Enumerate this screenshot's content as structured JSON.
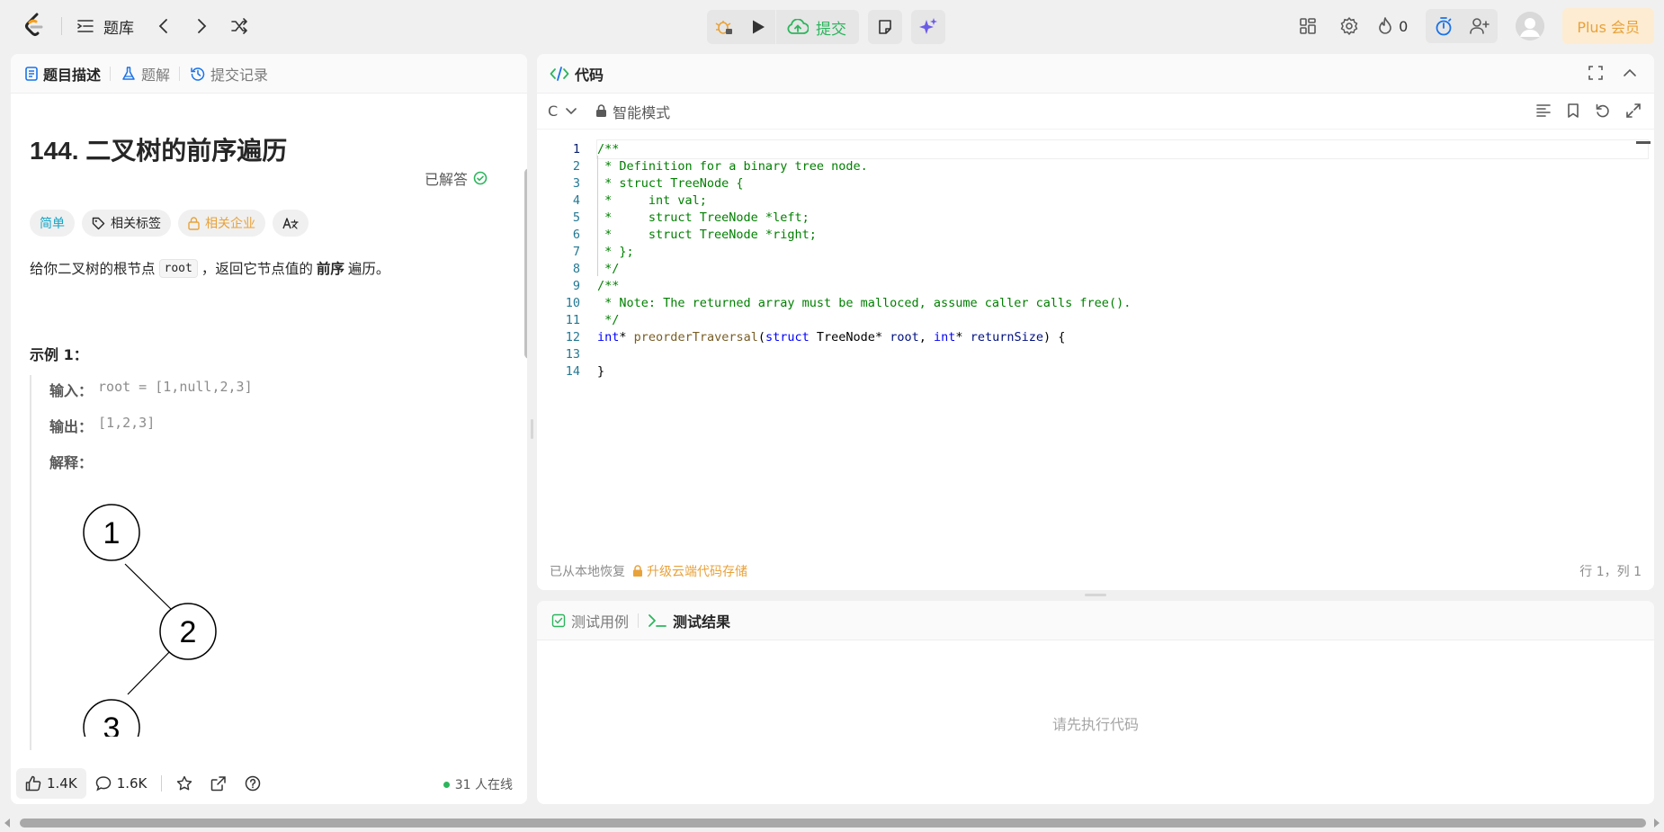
{
  "topbar": {
    "problemset_label": "题库",
    "submit_label": "提交",
    "streak_count": "0",
    "plus_label": "Plus 会员"
  },
  "left_panel": {
    "tabs": [
      {
        "label": "题目描述"
      },
      {
        "label": "题解"
      },
      {
        "label": "提交记录"
      }
    ],
    "title": "144. 二叉树的前序遍历",
    "solved_label": "已解答",
    "tags": {
      "difficulty": "简单",
      "related_tags": "相关标签",
      "companies": "相关企业"
    },
    "description": {
      "before": "给你二叉树的根节点",
      "code": "root",
      "middle": "，返回它节点值的",
      "bold": "前序",
      "after": "遍历。"
    },
    "example": {
      "title": "示例 1：",
      "input_label": "输入：",
      "input_value": "root = [1,null,2,3]",
      "output_label": "输出：",
      "output_value": "[1,2,3]",
      "explain_label": "解释：",
      "tree_nodes": [
        "1",
        "2",
        "3"
      ]
    },
    "footer": {
      "likes": "1.4K",
      "comments": "1.6K",
      "online": "31 人在线"
    }
  },
  "code_panel": {
    "title": "代码",
    "language": "C",
    "mode": "智能模式",
    "lines": [
      "/**",
      " * Definition for a binary tree node.",
      " * struct TreeNode {",
      " *     int val;",
      " *     struct TreeNode *left;",
      " *     struct TreeNode *right;",
      " * };",
      " */",
      "/**",
      " * Note: The returned array must be malloced, assume caller calls free().",
      " */",
      "int* preorderTraversal(struct TreeNode* root, int* returnSize) {",
      "",
      "}"
    ],
    "line_numbers": [
      "1",
      "2",
      "3",
      "4",
      "5",
      "6",
      "7",
      "8",
      "9",
      "10",
      "11",
      "12",
      "13",
      "14"
    ],
    "status_restored": "已从本地恢复",
    "status_upgrade": "升级云端代码存储",
    "cursor_pos": "行 1，列 1"
  },
  "test_panel": {
    "tabs": [
      {
        "label": "测试用例"
      },
      {
        "label": "测试结果"
      }
    ],
    "empty_text": "请先执行代码"
  },
  "colors": {
    "accent_green": "#2db55d",
    "easy_teal": "#17a5c6",
    "gold": "#e8a23a",
    "blue": "#1a73e8"
  }
}
